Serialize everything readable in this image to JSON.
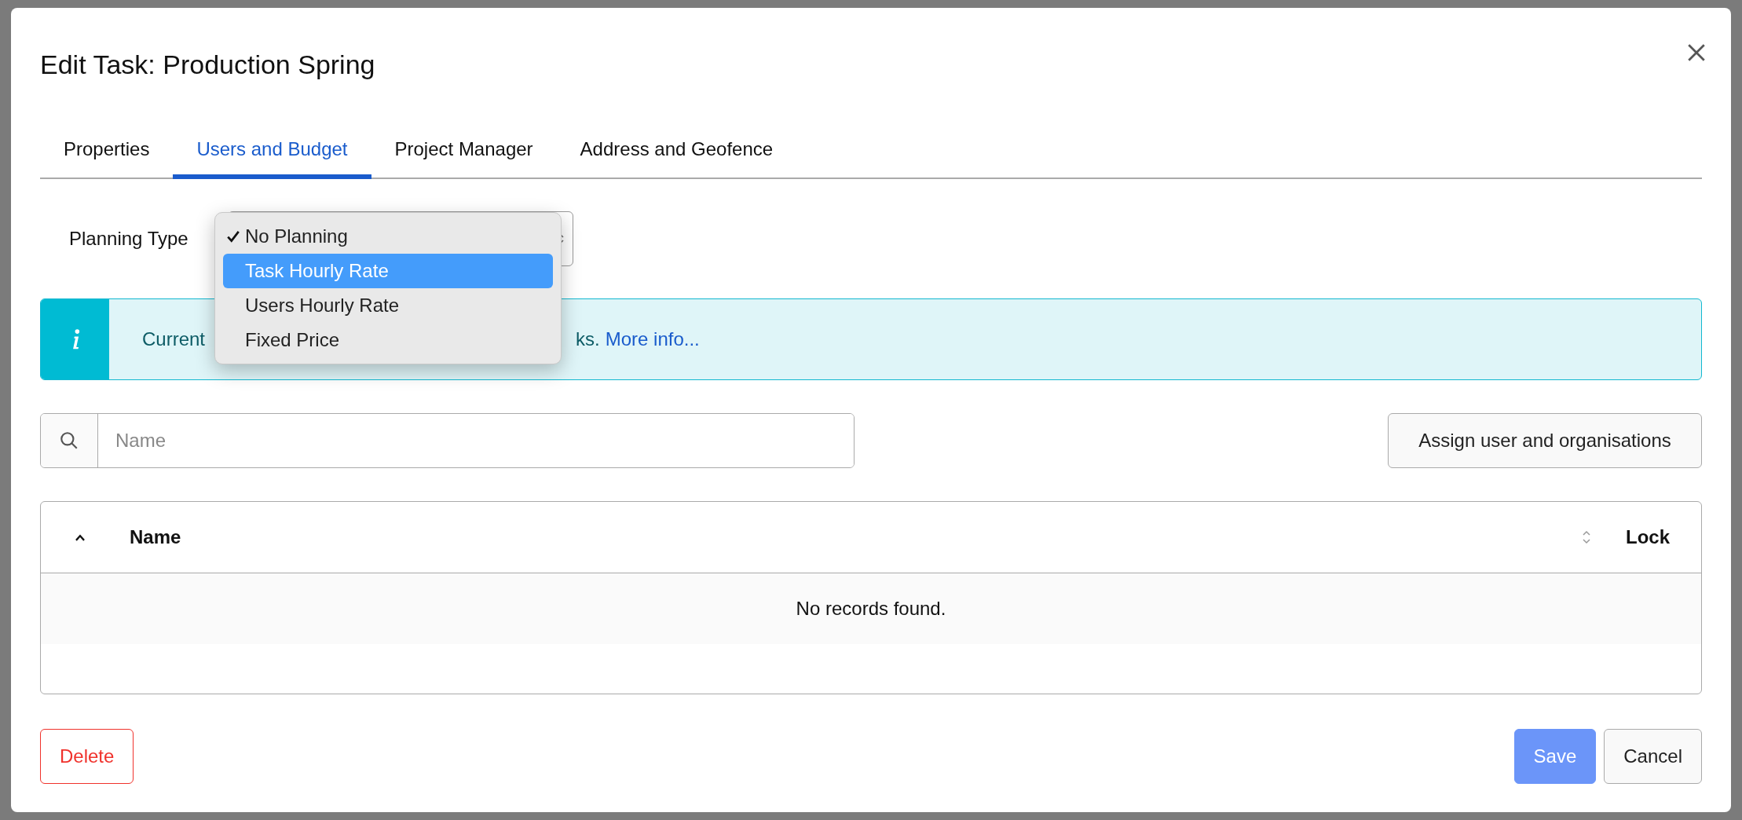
{
  "dialog": {
    "title": "Edit Task: Production Spring"
  },
  "tabs": [
    {
      "label": "Properties",
      "selected": false
    },
    {
      "label": "Users and Budget",
      "selected": true
    },
    {
      "label": "Project Manager",
      "selected": false
    },
    {
      "label": "Address and Geofence",
      "selected": false
    }
  ],
  "planning": {
    "label": "Planning Type",
    "options": [
      {
        "label": "No Planning",
        "selected": true,
        "highlighted": false
      },
      {
        "label": "Task Hourly Rate",
        "selected": false,
        "highlighted": true
      },
      {
        "label": "Users Hourly Rate",
        "selected": false,
        "highlighted": false
      },
      {
        "label": "Fixed Price",
        "selected": false,
        "highlighted": false
      }
    ]
  },
  "info": {
    "text_start": "Current",
    "text_end": "ks.",
    "link": "More info..."
  },
  "search": {
    "placeholder": "Name"
  },
  "assign_button": "Assign user and organisations",
  "table": {
    "columns": [
      {
        "label": "Name",
        "sortable": true
      },
      {
        "label": "Lock",
        "sortable": false
      }
    ],
    "empty_text": "No records found."
  },
  "buttons": [
    {
      "label": "Delete",
      "kind": "danger"
    },
    {
      "label": "Save",
      "kind": "primary"
    },
    {
      "label": "Cancel",
      "kind": "secondary"
    }
  ]
}
